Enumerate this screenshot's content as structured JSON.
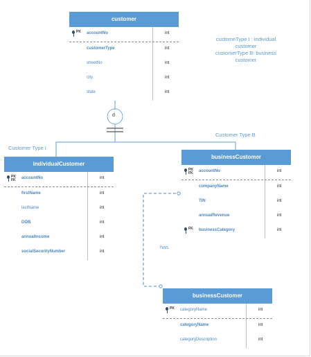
{
  "entities": {
    "customer": {
      "title": "customer",
      "rows": [
        {
          "name": "accountNo",
          "type": "int",
          "k1": "PK",
          "k2": ""
        },
        {
          "name": "customerType",
          "type": "int"
        },
        {
          "name": "streetNo",
          "type": "int"
        },
        {
          "name": "city",
          "type": "int"
        },
        {
          "name": "state",
          "type": "int"
        }
      ]
    },
    "individual": {
      "title": "individualCustomer",
      "rows": [
        {
          "name": "accountNo",
          "type": "int",
          "k1": "PK",
          "k2": "FK"
        },
        {
          "name": "firstName",
          "type": "int"
        },
        {
          "name": "lastName",
          "type": "int"
        },
        {
          "name": "DOB",
          "type": "int"
        },
        {
          "name": "annualIncome",
          "type": "int"
        },
        {
          "name": "socialSecurityNumber",
          "type": "int"
        }
      ]
    },
    "business": {
      "title": "businessCustomer",
      "rows": [
        {
          "name": "accountNo",
          "type": "int",
          "k1": "PK",
          "k2": "FK"
        },
        {
          "name": "companyName",
          "type": "int"
        },
        {
          "name": "TIN",
          "type": "int"
        },
        {
          "name": "annualRevenue",
          "type": "int"
        },
        {
          "name": "businessCategory",
          "type": "int",
          "k1": "FK",
          "k2": ""
        }
      ]
    },
    "category": {
      "title": "businessCustomer",
      "rows": [
        {
          "name": "categoryName",
          "type": "int",
          "k1": "PK",
          "k2": ""
        },
        {
          "name": "categoryName",
          "type": "int"
        },
        {
          "name": "categoryDescription",
          "type": "int"
        }
      ]
    }
  },
  "labels": {
    "disjoint": "d",
    "type_i": "Customer Type I",
    "type_b": "Customer Type B",
    "has": "has",
    "note_line1": "customeType I : individual",
    "note_line2": "customer",
    "note_line3": "customerType B: business",
    "note_line4": "customer"
  },
  "colors": {
    "header": "#5b9bd5",
    "field_text": "#4a86c5",
    "line": "#5b9bd5",
    "dashed": "#9a9a9a"
  }
}
